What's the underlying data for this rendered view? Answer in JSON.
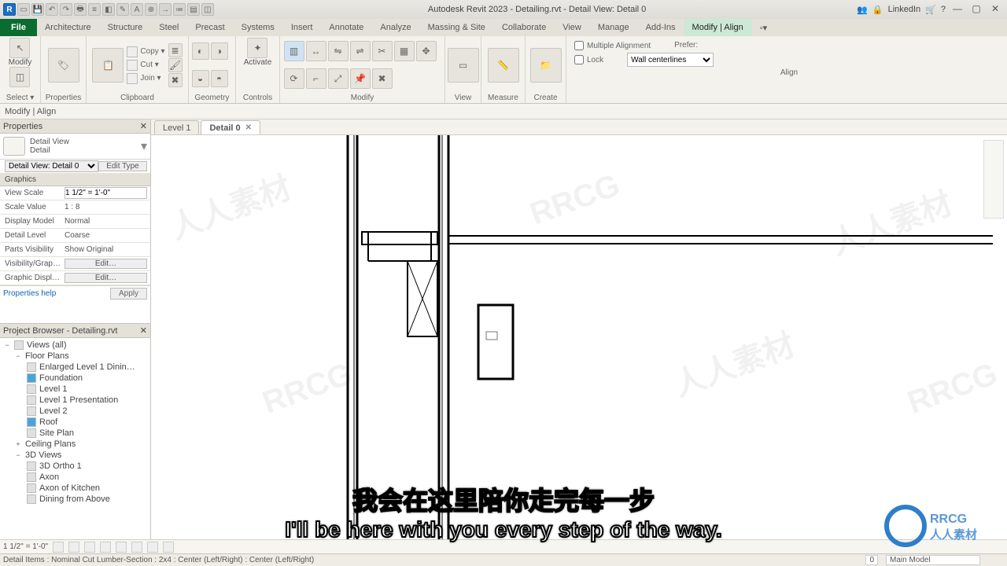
{
  "title": "Autodesk Revit 2023 - Detailing.rvt - Detail View: Detail 0",
  "account": "LinkedIn",
  "menutabs": {
    "file": "File",
    "items": [
      "Architecture",
      "Structure",
      "Steel",
      "Precast",
      "Systems",
      "Insert",
      "Annotate",
      "Analyze",
      "Massing & Site",
      "Collaborate",
      "View",
      "Manage",
      "Add-Ins",
      "Modify | Align"
    ],
    "active": "Modify | Align"
  },
  "ribbon": {
    "select": {
      "modify": "Modify",
      "label": "Select ▾"
    },
    "properties": {
      "label": "Properties"
    },
    "clipboard": {
      "paste": "Paste",
      "copy": "Copy ▾",
      "cut": "Cut ▾",
      "join": "Join ▾",
      "label": "Clipboard"
    },
    "geometry": {
      "label": "Geometry"
    },
    "controls": {
      "activate": "Activate",
      "label": "Controls"
    },
    "modify": {
      "label": "Modify"
    },
    "view": {
      "label": "View"
    },
    "measure": {
      "label": "Measure"
    },
    "create": {
      "label": "Create"
    },
    "align": {
      "multi": "Multiple Alignment",
      "lock": "Lock",
      "prefer": "Prefer:",
      "preferopt": "Wall centerlines",
      "label": "Align"
    }
  },
  "ctx": "Modify | Align",
  "properties": {
    "title": "Properties",
    "type_line1": "Detail View",
    "type_line2": "Detail",
    "instance": "Detail View: Detail 0",
    "edit_type": "Edit Type",
    "section": "Graphics",
    "rows": {
      "view_scale_k": "View Scale",
      "view_scale_v": "1 1/2\" = 1'-0\"",
      "scale_value_k": "Scale Value",
      "scale_value_v": "1 : 8",
      "display_model_k": "Display Model",
      "display_model_v": "Normal",
      "detail_level_k": "Detail Level",
      "detail_level_v": "Coarse",
      "parts_vis_k": "Parts Visibility",
      "parts_vis_v": "Show Original",
      "vis_graph_k": "Visibility/Grap…",
      "vis_graph_btn": "Edit…",
      "graph_disp_k": "Graphic Displ…",
      "graph_disp_btn": "Edit…"
    },
    "help": "Properties help",
    "apply": "Apply"
  },
  "browser": {
    "title": "Project Browser - Detailing.rvt",
    "root": "Views (all)",
    "floor_plans": "Floor Plans",
    "fp_items": [
      "Enlarged Level 1 Dinin…",
      "Foundation",
      "Level 1",
      "Level 1 Presentation",
      "Level 2",
      "Roof",
      "Site Plan"
    ],
    "ceiling_plans": "Ceiling Plans",
    "three_d": "3D Views",
    "td_items": [
      "3D Ortho 1",
      "Axon",
      "Axon of Kitchen",
      "Dining from Above"
    ]
  },
  "viewtabs": {
    "t1": "Level 1",
    "t2": "Detail 0"
  },
  "viewstatus": {
    "scale": "1 1/2\" = 1'-0\""
  },
  "appstatus": {
    "hint": "Detail Items : Nominal Cut Lumber-Section : 2x4 : Center (Left/Right) : Center (Left/Right)",
    "zero": "0",
    "main_model": "Main Model"
  },
  "subtitles": {
    "cn": "我会在这里陪你走完每一步",
    "en": "I'll be here with you every step of the way."
  },
  "brand": {
    "t1": "RRCG",
    "t2": "人人素材"
  }
}
